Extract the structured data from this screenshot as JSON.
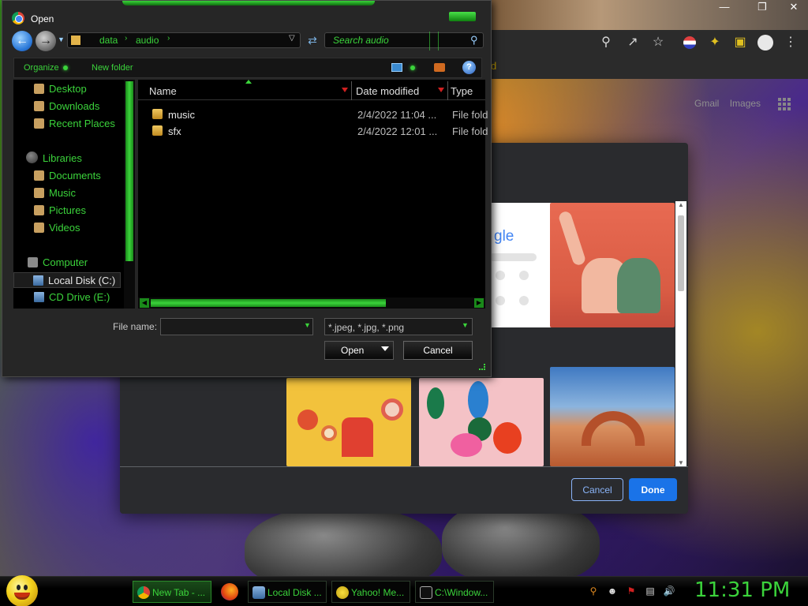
{
  "open_dialog": {
    "title": "Open",
    "breadcrumbs": [
      "data",
      "audio"
    ],
    "search_placeholder": "Search audio",
    "toolbar": {
      "organize": "Organize",
      "new_folder": "New folder"
    },
    "nav_items": [
      {
        "label": "Desktop",
        "icon": "desktop-icon"
      },
      {
        "label": "Downloads",
        "icon": "downloads-icon"
      },
      {
        "label": "Recent Places",
        "icon": "recent-places-icon"
      },
      {
        "label": "Libraries",
        "icon": "libraries-icon"
      },
      {
        "label": "Documents",
        "icon": "documents-icon"
      },
      {
        "label": "Music",
        "icon": "music-icon"
      },
      {
        "label": "Pictures",
        "icon": "pictures-icon"
      },
      {
        "label": "Videos",
        "icon": "videos-icon"
      },
      {
        "label": "Computer",
        "icon": "computer-icon"
      },
      {
        "label": "Local Disk (C:)",
        "icon": "drive-icon"
      },
      {
        "label": "CD Drive (E:)",
        "icon": "cd-drive-icon"
      }
    ],
    "columns": {
      "name": "Name",
      "date": "Date modified",
      "type": "Type"
    },
    "files": [
      {
        "name": "music",
        "date": "2/4/2022 11:04 ...",
        "type": "File fold"
      },
      {
        "name": "sfx",
        "date": "2/4/2022 12:01 ...",
        "type": "File fold"
      }
    ],
    "file_name_label": "File name:",
    "file_name_value": "",
    "file_type": "*.jpeg, *.jpg, *.png",
    "open_label": "Open",
    "cancel_label": "Cancel"
  },
  "browser": {
    "bookmark_fragment": "d",
    "links": [
      "Gmail",
      "Images"
    ],
    "tile_google_text": "gle"
  },
  "customize_dialog": {
    "cancel_label": "Cancel",
    "done_label": "Done"
  },
  "taskbar": {
    "tasks": [
      {
        "label": "New Tab - ...",
        "icon": "chrome-icon",
        "active": true
      },
      {
        "label": "Local Disk ...",
        "icon": "drive-icon",
        "active": false
      },
      {
        "label": "Yahoo! Me...",
        "icon": "yahoo-messenger-icon",
        "active": false
      },
      {
        "label": "C:\\Window...",
        "icon": "cmd-icon",
        "active": false
      }
    ],
    "clock": "11:31 PM"
  },
  "colors": {
    "accent_green": "#3bd33b",
    "chrome_blue": "#1a73e8",
    "link_blue": "#8ab4f8"
  }
}
